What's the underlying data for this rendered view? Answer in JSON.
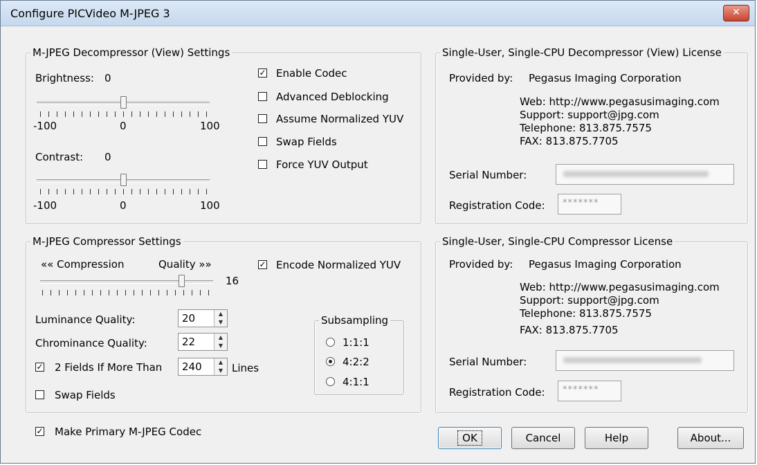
{
  "window": {
    "title": "Configure PICVideo M-JPEG 3",
    "close_glyph": "✕"
  },
  "decompressor": {
    "legend": "M-JPEG Decompressor (View) Settings",
    "brightness_label": "Brightness:",
    "brightness_value": "0",
    "contrast_label": "Contrast:",
    "contrast_value": "0",
    "scale_min": "-100",
    "scale_mid": "0",
    "scale_max": "100",
    "brightness_level": 0,
    "contrast_level": 0,
    "checkboxes": [
      {
        "label": "Enable Codec",
        "checked": true
      },
      {
        "label": "Advanced Deblocking",
        "checked": false
      },
      {
        "label": "Assume Normalized YUV",
        "checked": false
      },
      {
        "label": "Swap Fields",
        "checked": false
      },
      {
        "label": "Force YUV Output",
        "checked": false
      }
    ]
  },
  "compressor": {
    "legend": "M-JPEG Compressor Settings",
    "compression_label": "«« Compression",
    "quality_label": "Quality »»",
    "quality_value": "16",
    "encode_label": "Encode Normalized YUV",
    "encode_checked": true,
    "luminance_label": "Luminance Quality:",
    "luminance_value": "20",
    "chrominance_label": "Chrominance Quality:",
    "chrominance_value": "22",
    "fields_label": "2 Fields If More Than",
    "fields_value": "240",
    "fields_suffix": "Lines",
    "fields_checked": true,
    "swap_label": "Swap Fields",
    "swap_checked": false,
    "subsampling": {
      "legend": "Subsampling",
      "options": [
        {
          "label": "1:1:1",
          "selected": false
        },
        {
          "label": "4:2:2",
          "selected": true
        },
        {
          "label": "4:1:1",
          "selected": false
        }
      ]
    }
  },
  "primary_label": "Make Primary M-JPEG Codec",
  "primary_checked": true,
  "decomp_license": {
    "legend": "Single-User, Single-CPU Decompressor (View) License",
    "provided_label": "Provided by:",
    "provider": "Pegasus Imaging Corporation",
    "web": "Web: http://www.pegasusimaging.com",
    "support": "Support: support@jpg.com",
    "telephone": "Telephone: 813.875.7575",
    "fax": "FAX: 813.875.7705",
    "serial_label": "Serial Number:",
    "reg_label": "Registration Code:",
    "reg_mask": "*******"
  },
  "comp_license": {
    "legend": "Single-User, Single-CPU Compressor License",
    "provided_label": "Provided by:",
    "provider": "Pegasus Imaging Corporation",
    "web": "Web: http://www.pegasusimaging.com",
    "support": "Support: support@jpg.com",
    "telephone": "Telephone: 813.875.7575",
    "fax": "FAX: 813.875.7705",
    "serial_label": "Serial Number:",
    "reg_label": "Registration Code:",
    "reg_mask": "*******"
  },
  "buttons": {
    "ok": "OK",
    "cancel": "Cancel",
    "help": "Help",
    "about": "About..."
  }
}
